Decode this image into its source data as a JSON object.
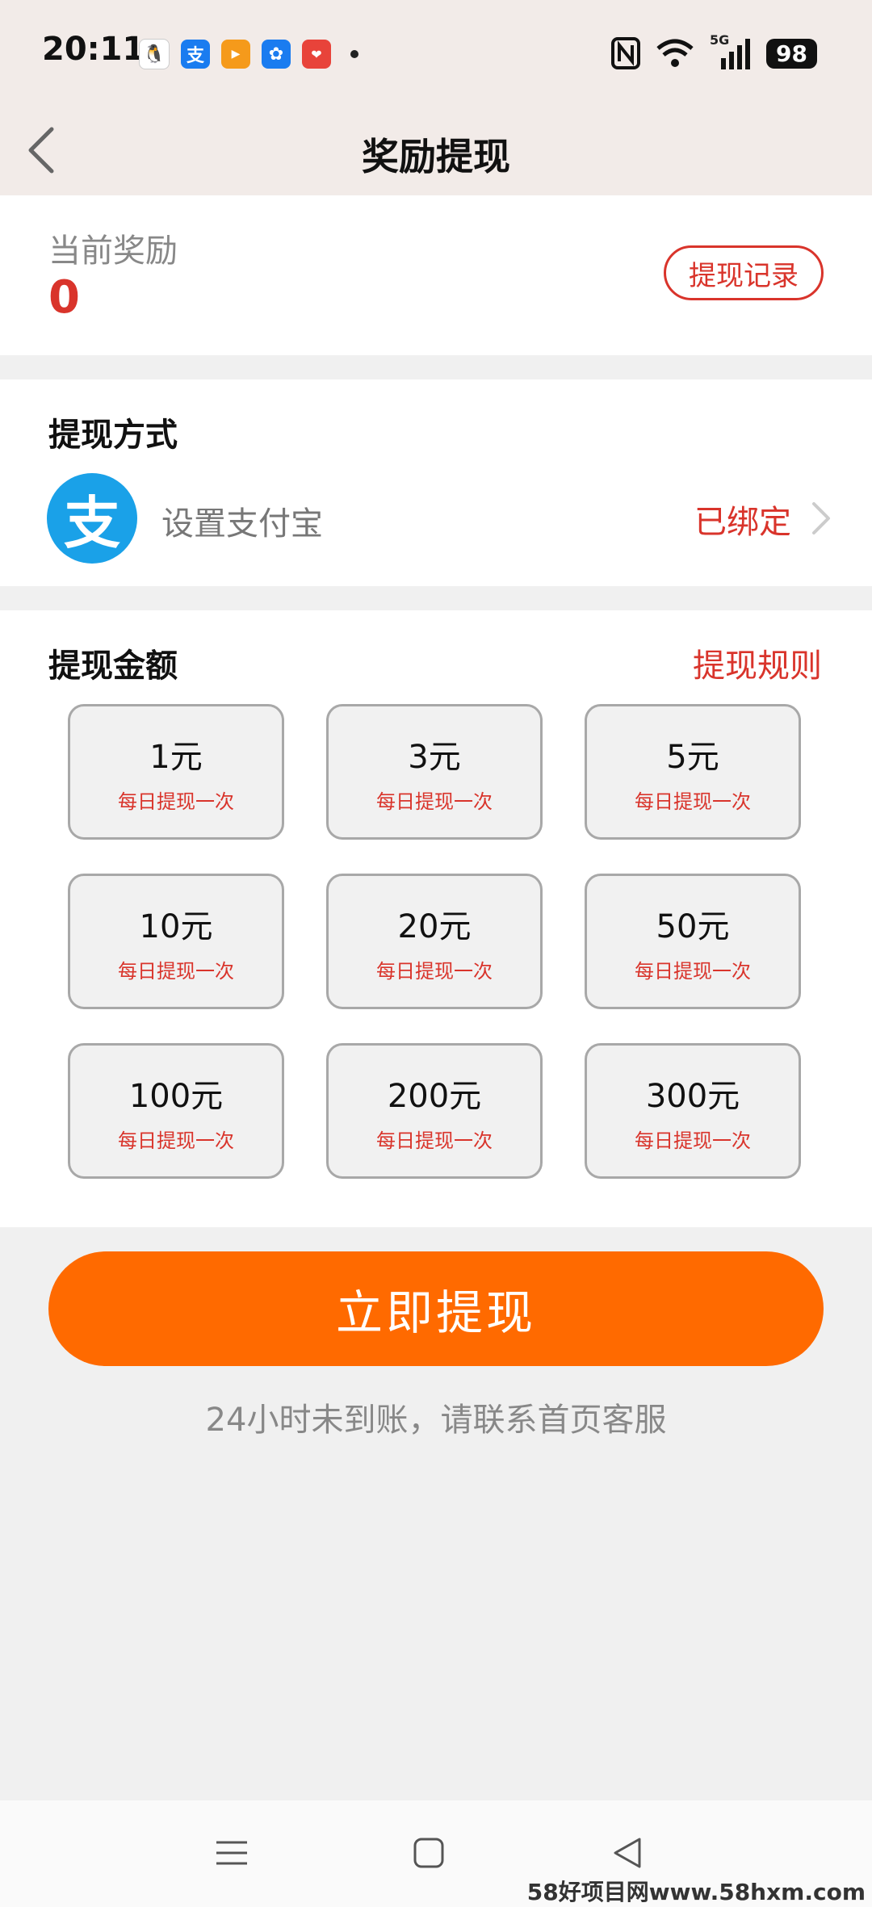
{
  "status_bar": {
    "time": "20:11",
    "battery": "98",
    "signal_label": "5G"
  },
  "header": {
    "title": "奖励提现"
  },
  "reward": {
    "label": "当前奖励",
    "value": "0",
    "record_button": "提现记录"
  },
  "method": {
    "title": "提现方式",
    "icon_glyph": "支",
    "name": "设置支付宝",
    "status": "已绑定"
  },
  "amount": {
    "title": "提现金额",
    "rules_link": "提现规则",
    "options": [
      {
        "value": "1元",
        "note": "每日提现一次"
      },
      {
        "value": "3元",
        "note": "每日提现一次"
      },
      {
        "value": "5元",
        "note": "每日提现一次"
      },
      {
        "value": "10元",
        "note": "每日提现一次"
      },
      {
        "value": "20元",
        "note": "每日提现一次"
      },
      {
        "value": "50元",
        "note": "每日提现一次"
      },
      {
        "value": "100元",
        "note": "每日提现一次"
      },
      {
        "value": "200元",
        "note": "每日提现一次"
      },
      {
        "value": "300元",
        "note": "每日提现一次"
      }
    ]
  },
  "action": {
    "withdraw_button": "立即提现",
    "help_text": "24小时未到账，请联系首页客服"
  },
  "watermark": "58好项目网www.58hxm.com",
  "colors": {
    "accent_red": "#d9342b",
    "button_orange": "#ff6a00",
    "alipay_blue": "#1aa1e8",
    "header_bg": "#f2ebe8"
  }
}
